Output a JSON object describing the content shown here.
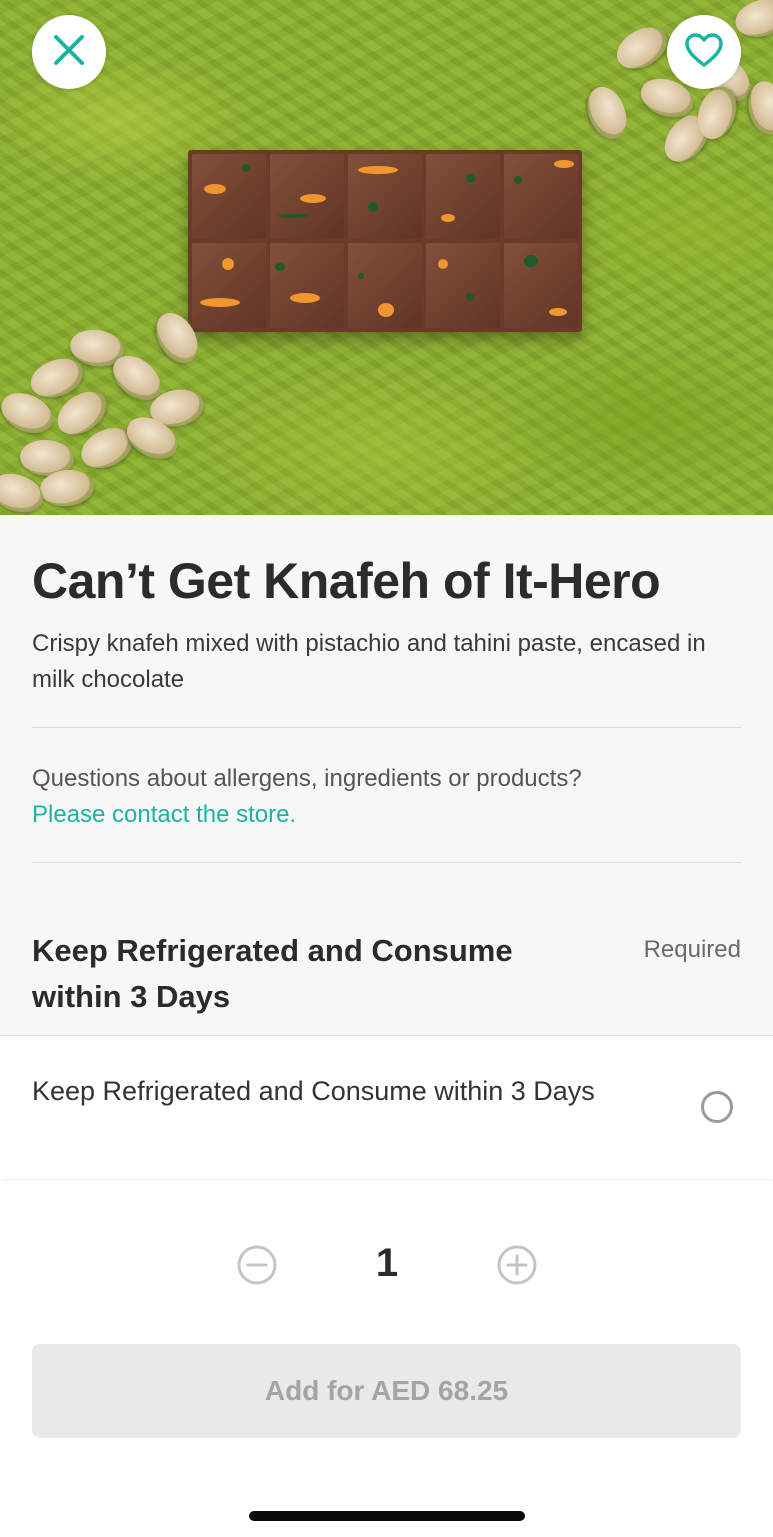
{
  "product": {
    "title": "Can’t Get Knafeh of It-Hero",
    "description": "Crispy knafeh mixed with pistachio and tahini paste, encased in milk chocolate"
  },
  "header": {
    "close_icon": "close-icon",
    "favorite_icon": "heart-icon"
  },
  "help": {
    "question": "Questions about allergens, ingredients or products?",
    "link_text": "Please contact the store."
  },
  "option_group": {
    "title": "Keep Refrigerated and Consume within 3 Days",
    "required_label": "Required",
    "options": [
      {
        "label": "Keep Refrigerated and Consume within 3 Days",
        "selected": false
      }
    ]
  },
  "quantity": {
    "value": "1",
    "decrement_icon": "minus-circle-icon",
    "increment_icon": "plus-circle-icon"
  },
  "cta": {
    "label": "Add for AED 68.25",
    "enabled": false
  },
  "colors": {
    "accent": "#17b5a2",
    "button_disabled_bg": "#e9e9ea",
    "button_disabled_text": "#a4a4a6"
  }
}
